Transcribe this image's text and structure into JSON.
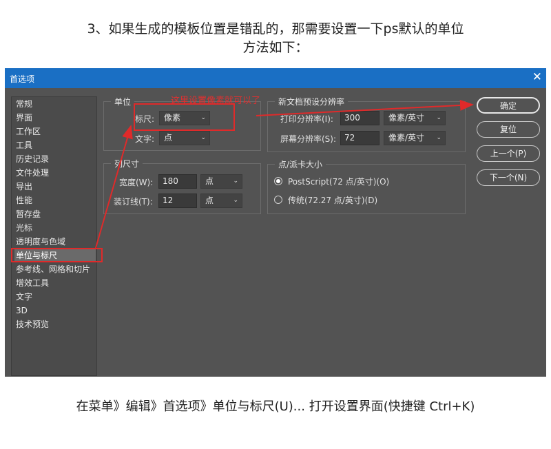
{
  "heading": {
    "line1": "3、如果生成的模板位置是错乱的，那需要设置一下ps默认的单位",
    "line2": "方法如下："
  },
  "dialog": {
    "title": "首选项",
    "close_glyph": "✕",
    "sidebar": [
      "常规",
      "界面",
      "工作区",
      "工具",
      "历史记录",
      "文件处理",
      "导出",
      "性能",
      "暂存盘",
      "光标",
      "透明度与色域",
      "单位与标尺",
      "参考线、网格和切片",
      "增效工具",
      "文字",
      "3D",
      "技术预览"
    ],
    "selected_index": 11,
    "units": {
      "group_label": "单位",
      "ruler_label": "标尺:",
      "ruler_value": "像素",
      "type_label": "文字:",
      "type_value": "点"
    },
    "annotation": "这里设置像素就可以了",
    "resolution": {
      "group_label": "新文档预设分辨率",
      "print_label": "打印分辨率(I):",
      "print_value": "300",
      "print_unit": "像素/英寸",
      "screen_label": "屏幕分辨率(S):",
      "screen_value": "72",
      "screen_unit": "像素/英寸"
    },
    "columns": {
      "group_label": "列尺寸",
      "width_label": "宽度(W):",
      "width_value": "180",
      "width_unit": "点",
      "gutter_label": "装订线(T):",
      "gutter_value": "12",
      "gutter_unit": "点"
    },
    "point_size": {
      "group_label": "点/派卡大小",
      "postscript_label": "PostScript(72 点/英寸)(O)",
      "traditional_label": "传统(72.27 点/英寸)(D)"
    },
    "buttons": {
      "ok": "确定",
      "reset": "复位",
      "prev": "上一个(P)",
      "next": "下一个(N)"
    }
  },
  "footer": "在菜单》编辑》首选项》单位与标尺(U)... 打开设置界面(快捷键 Ctrl+K)",
  "colors": {
    "annotation_red": "#e02a2a",
    "titlebar_blue": "#1a6fc4",
    "dialog_bg": "#535353"
  }
}
